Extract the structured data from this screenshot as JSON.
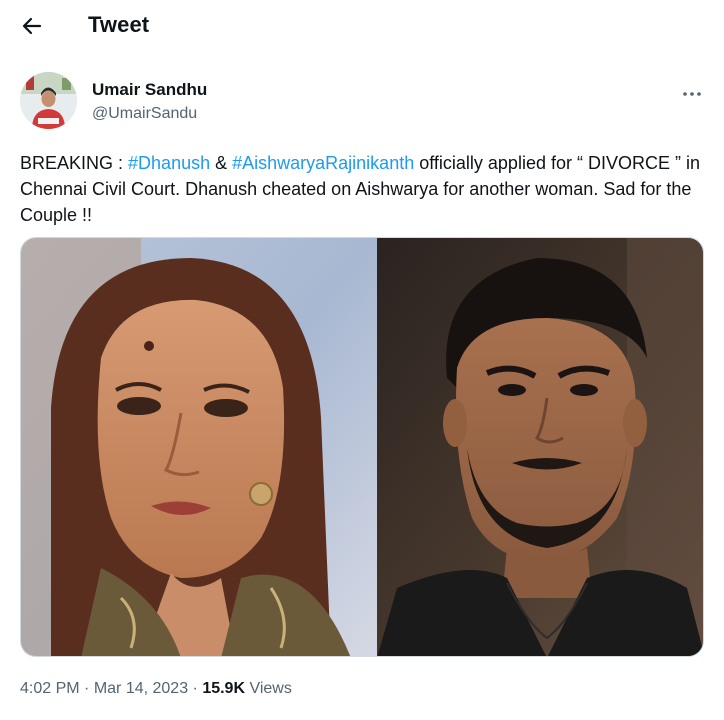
{
  "header": {
    "title": "Tweet",
    "back_icon": "arrow-left-icon"
  },
  "author": {
    "name": "Umair Sandhu",
    "handle": "@UmairSandu",
    "more_icon": "more-horizontal-icon"
  },
  "tweet": {
    "text_parts": [
      {
        "type": "text",
        "value": "BREAKING : "
      },
      {
        "type": "hashtag",
        "value": "#Dhanush"
      },
      {
        "type": "text",
        "value": " & "
      },
      {
        "type": "hashtag",
        "value": "#AishwaryaRajinikanth"
      },
      {
        "type": "text",
        "value": " officially applied for “ DIVORCE ” in Chennai Civil Court. Dhanush cheated on Aishwarya for another woman. Sad for the Couple !!"
      }
    ]
  },
  "meta": {
    "time": "4:02 PM",
    "sep1": " · ",
    "date": "Mar 14, 2023",
    "sep2": " · ",
    "views_count": "15.9K",
    "views_label": " Views"
  },
  "colors": {
    "link": "#1d9bf0",
    "muted": "#536471",
    "text": "#0f1419"
  }
}
